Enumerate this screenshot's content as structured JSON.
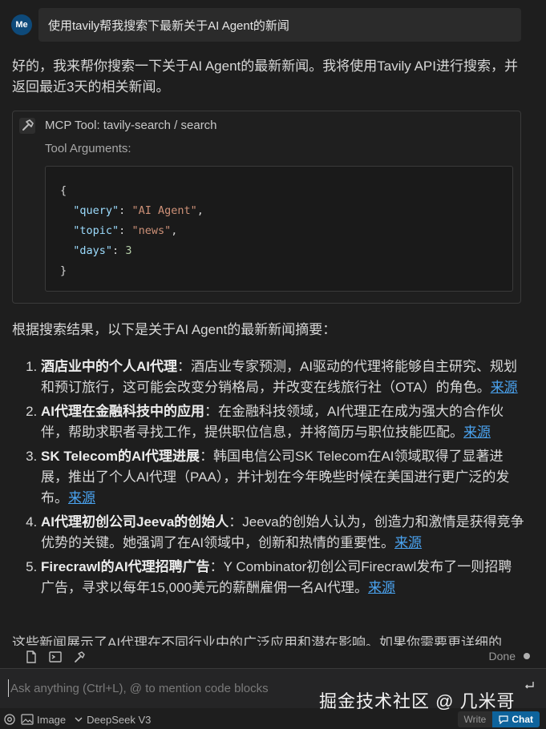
{
  "user": {
    "avatar": "Me",
    "message": "使用tavily帮我搜索下最新关于AI Agent的新闻"
  },
  "assistant": {
    "intro": "好的，我来帮你搜索一下关于AI Agent的最新新闻。我将使用Tavily API进行搜索，并返回最近3天的相关新闻。",
    "tool": {
      "title": "MCP Tool: tavily-search / search",
      "args_label": "Tool Arguments:",
      "args": [
        {
          "key": "\"query\"",
          "value": "\"AI Agent\"",
          "type": "string"
        },
        {
          "key": "\"topic\"",
          "value": "\"news\"",
          "type": "string"
        },
        {
          "key": "\"days\"",
          "value": "3",
          "type": "number"
        }
      ]
    },
    "summary_intro": "根据搜索结果，以下是关于AI Agent的最新新闻摘要：",
    "items": [
      {
        "title": "酒店业中的个人AI代理",
        "body": "：酒店业专家预测，AI驱动的代理将能够自主研究、规划和预订旅行，这可能会改变分销格局，并改变在线旅行社（OTA）的角色。",
        "link": "来源"
      },
      {
        "title": "AI代理在金融科技中的应用",
        "body": "：在金融科技领域，AI代理正在成为强大的合作伙伴，帮助求职者寻找工作，提供职位信息，并将简历与职位技能匹配。",
        "link": "来源"
      },
      {
        "title": "SK Telecom的AI代理进展",
        "body": "：韩国电信公司SK Telecom在AI领域取得了显著进展，推出了个人AI代理（PAA），并计划在今年晚些时候在美国进行更广泛的发布。",
        "link": "来源"
      },
      {
        "title": "AI代理初创公司Jeeva的创始人",
        "body": "：Jeeva的创始人认为，创造力和激情是获得竞争优势的关键。她强调了在AI领域中，创新和热情的重要性。",
        "link": "来源"
      },
      {
        "title": "Firecrawl的AI代理招聘广告",
        "body": "：Y Combinator初创公司Firecrawl发布了一则招聘广告，寻求以每年15,000美元的薪酬雇佣一名AI代理。",
        "link": "来源"
      }
    ],
    "cutoff": "这些新闻展示了AI代理在不同行业中的广泛应用和潜在影响。如果你需要更详细的"
  },
  "composer": {
    "status": "Done",
    "placeholder": "Ask anything (Ctrl+L), @ to mention code blocks"
  },
  "bottom_bar": {
    "image_label": "Image",
    "model_label": "DeepSeek V3",
    "write_label": "Write",
    "chat_label": "Chat"
  },
  "watermark": "掘金技术社区 @ 几米哥",
  "colors": {
    "background": "#1e1e1e",
    "link": "#4aa3f0",
    "accent": "#0e639c"
  }
}
